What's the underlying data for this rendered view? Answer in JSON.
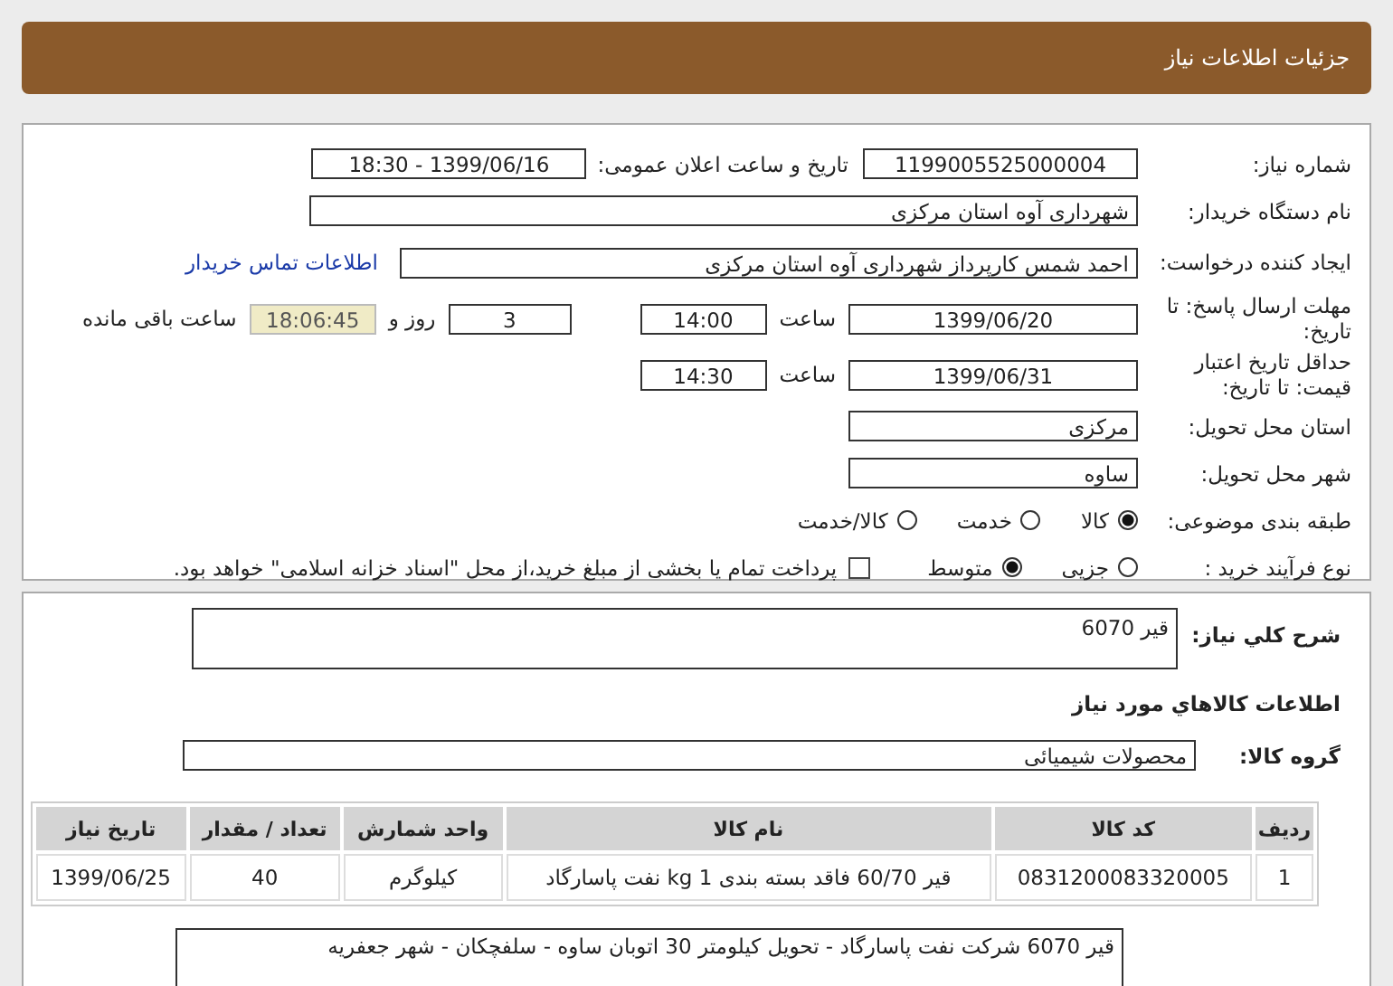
{
  "header": {
    "title": "جزئیات اطلاعات نیاز"
  },
  "details": {
    "need_number": {
      "label": "شماره نیاز:",
      "value": "1199005525000004"
    },
    "announce": {
      "label": "تاریخ و ساعت اعلان عمومی:",
      "value": "1399/06/16 - 18:30"
    },
    "buyer": {
      "label": "نام دستگاه خریدار:",
      "value": "شهرداری آوه استان مرکزی"
    },
    "creator": {
      "label": "ایجاد کننده درخواست:",
      "value": "احمد  شمس کارپرداز شهرداری آوه استان مرکزی",
      "link": "اطلاعات تماس خریدار"
    },
    "deadline": {
      "label": "مهلت ارسال پاسخ: تا تاریخ:",
      "date": "1399/06/20",
      "time_label": "ساعت",
      "time": "14:00",
      "days": "3",
      "days_label": "روز و",
      "remaining": "18:06:45",
      "remaining_label": "ساعت باقی مانده"
    },
    "validity": {
      "label": "حداقل تاریخ اعتبار قیمت: تا تاریخ:",
      "date": "1399/06/31",
      "time_label": "ساعت",
      "time": "14:30"
    },
    "province": {
      "label": "استان محل تحویل:",
      "value": "مرکزی"
    },
    "city": {
      "label": "شهر محل تحویل:",
      "value": "ساوه"
    },
    "category": {
      "label": "طبقه بندی موضوعی:",
      "options": [
        {
          "label": "کالا",
          "selected": true
        },
        {
          "label": "خدمت",
          "selected": false
        },
        {
          "label": "کالا/خدمت",
          "selected": false
        }
      ]
    },
    "process": {
      "label": "نوع فرآیند خرید :",
      "options": [
        {
          "label": "جزیی",
          "selected": false
        },
        {
          "label": "متوسط",
          "selected": true
        }
      ],
      "treasury": {
        "label": "پرداخت تمام یا بخشی از مبلغ خرید،از محل \"اسناد خزانه اسلامی\" خواهد بود.",
        "checked": false
      }
    }
  },
  "goods": {
    "summary": {
      "label": "شرح کلي نیاز:",
      "value": "قیر 6070"
    },
    "heading": "اطلاعات کالاهاي مورد نیاز",
    "group": {
      "label": "گروه کالا:",
      "value": "محصولات شیمیائی"
    },
    "table": {
      "columns": [
        "ردیف",
        "کد کالا",
        "نام کالا",
        "واحد شمارش",
        "تعداد / مقدار",
        "تاریخ نیاز"
      ],
      "rows": [
        [
          "1",
          "0831200083320005",
          "قیر 60/70 فاقد بسته بندی 1 kg نفت پاسارگاد",
          "کیلوگرم",
          "40",
          "1399/06/25"
        ]
      ]
    },
    "note": "قیر 6070 شرکت نفت پاسارگاد - تحویل کیلومتر 30 اتوبان ساوه - سلفچکان - شهر جعفریه"
  }
}
